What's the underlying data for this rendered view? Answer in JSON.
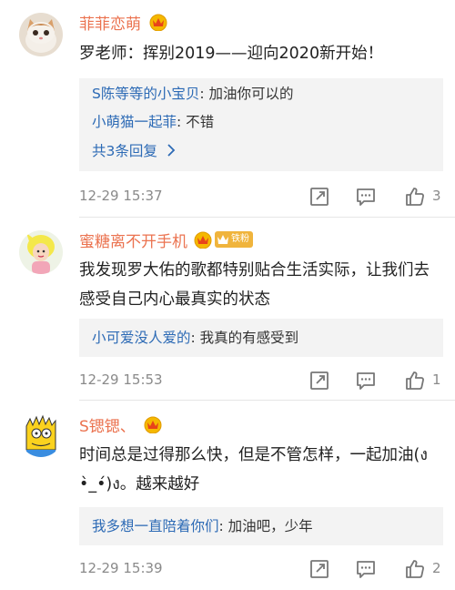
{
  "colors": {
    "username": "#eb7350",
    "reply_name": "#2c6ab5",
    "meta": "#8a8a8a",
    "reply_bg": "#f3f3f3",
    "badge": "#f0b43c"
  },
  "comments": [
    {
      "username": "菲菲恋萌",
      "vip_icon": "vip-crown-icon",
      "text": "罗老师：挥别2019——迎向2020新开始！",
      "replies": [
        {
          "name": "S陈等等的小宝贝",
          "text": ": 加油你可以的"
        },
        {
          "name": "小萌猫一起菲",
          "text": ": 不错"
        }
      ],
      "more_replies": "共3条回复",
      "time": "12-29 15:37",
      "likes": "3"
    },
    {
      "username": "蜜糖离不开手机",
      "vip_icon": "vip-crown-icon",
      "badge": "铁粉",
      "text": "我发现罗大佑的歌都特别贴合生活实际，让我们去感受自己内心最真实的状态",
      "replies": [
        {
          "name": "小可爱没人爱的",
          "text": ": 我真的有感受到"
        }
      ],
      "time": "12-29 15:53",
      "likes": "1"
    },
    {
      "username": "S锶锶、",
      "vip_icon": "vip-crown-icon",
      "text": "时间总是过得那么快，但是不管怎样，一起加油(ง •̀_•́)ง。越来越好",
      "replies": [
        {
          "name": "我多想一直陪着你们",
          "text": ": 加油吧，少年"
        }
      ],
      "time": "12-29 15:39",
      "likes": "2"
    }
  ],
  "icons": {
    "share": "share-icon",
    "comment": "comment-icon",
    "like": "thumbs-up-icon",
    "chevron": "chevron-right-icon"
  }
}
